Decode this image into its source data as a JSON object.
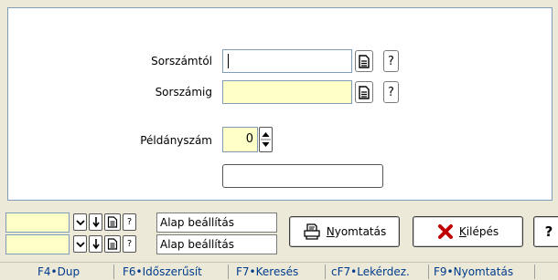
{
  "form": {
    "from_label": "Sorszámtól",
    "from_value": "",
    "to_label": "Sorszámig",
    "to_value": "",
    "copies_label": "Példányszám",
    "copies_value": "0",
    "extra_value": "",
    "help_glyph": "?"
  },
  "presets": [
    {
      "label": "Alap beállítás",
      "value": ""
    },
    {
      "label": "Alap beállítás",
      "value": ""
    }
  ],
  "buttons": {
    "print_label": "Nyomtatás",
    "print_mnemonic": "N",
    "exit_label": "Kilépés",
    "exit_mnemonic": "K",
    "help_label": "?"
  },
  "statusbar": {
    "items": [
      "F4•Dup",
      "F6•Időszerűsít",
      "F7•Keresés",
      "cF7•Lekérdez.",
      "F9•Nyomtatás"
    ]
  },
  "colors": {
    "panel_bg": "#ffffff",
    "required_field_bg": "#ffffc8",
    "window_bg": "#ece9d8",
    "statusbar_text": "#003c8c",
    "exit_icon": "#c00000"
  }
}
